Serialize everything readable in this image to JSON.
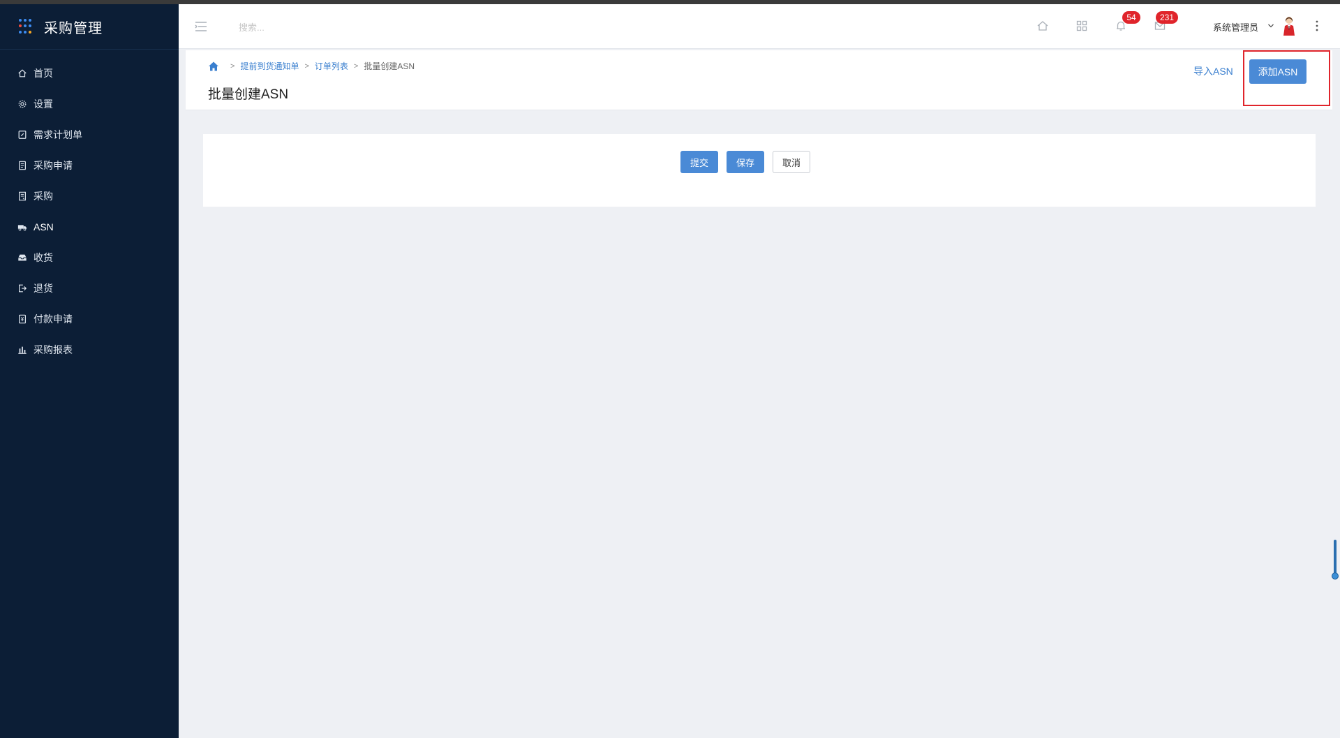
{
  "app": {
    "title": "采购管理",
    "brand_dot_colors": [
      "#3d8bf0",
      "#3d8bf0",
      "#3d8bf0",
      "#f04b3d",
      "#3d8bf0",
      "#3d8bf0",
      "#3d8bf0",
      "#3d8bf0",
      "#f5a623"
    ]
  },
  "sidebar": {
    "items": [
      {
        "label": "首页",
        "icon": "home-icon"
      },
      {
        "label": "设置",
        "icon": "gear-icon"
      },
      {
        "label": "需求计划单",
        "icon": "edit-doc-icon"
      },
      {
        "label": "采购申请",
        "icon": "clipboard-icon"
      },
      {
        "label": "采购",
        "icon": "receipt-icon"
      },
      {
        "label": "ASN",
        "icon": "truck-icon"
      },
      {
        "label": "收货",
        "icon": "inbox-icon"
      },
      {
        "label": "退货",
        "icon": "sign-out-icon"
      },
      {
        "label": "付款申请",
        "icon": "payment-doc-icon"
      },
      {
        "label": "采购报表",
        "icon": "bar-chart-icon"
      }
    ],
    "active_index": 5
  },
  "topbar": {
    "search_placeholder": "搜索...",
    "notifications_count": "54",
    "messages_count": "231",
    "user_name": "系统管理员"
  },
  "page": {
    "breadcrumb": {
      "items": [
        "提前到货通知单",
        "订单列表"
      ],
      "current": "批量创建ASN",
      "separator": ">"
    },
    "title": "批量创建ASN",
    "import_link": "导入ASN",
    "add_button": "添加ASN"
  },
  "form_actions": {
    "submit": "提交",
    "save": "保存",
    "cancel": "取消"
  },
  "colors": {
    "sidebar_bg": "#0c1e36",
    "primary": "#4a8ad6",
    "link": "#3a7fcf",
    "badge": "#e0242b",
    "highlight": "#e0242b"
  }
}
